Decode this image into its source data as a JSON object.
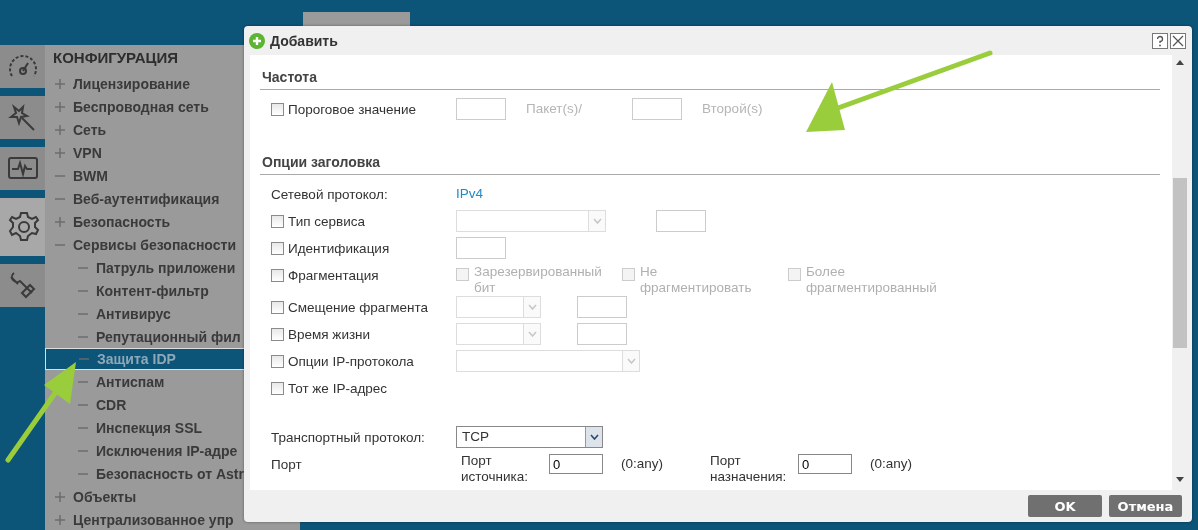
{
  "sidebar_icons": [
    {
      "selected": false
    },
    {
      "selected": false
    },
    {
      "selected": false
    },
    {
      "selected": true
    },
    {
      "selected": false
    }
  ],
  "nav": {
    "title": "КОНФИГУРАЦИЯ",
    "items": [
      {
        "label": "Лицензирование",
        "expanded": false,
        "selected": false
      },
      {
        "label": "Беспроводная сеть",
        "expanded": false,
        "selected": false
      },
      {
        "label": "Сеть",
        "expanded": false,
        "selected": false
      },
      {
        "label": "VPN",
        "expanded": false,
        "selected": false
      },
      {
        "label": "BWM",
        "expanded": true,
        "selected": false
      },
      {
        "label": "Веб-аутентификация",
        "expanded": true,
        "selected": false
      },
      {
        "label": "Безопасность",
        "expanded": false,
        "selected": false
      },
      {
        "label": "Сервисы безопасности",
        "expanded": true,
        "selected": false,
        "children": [
          {
            "label": "Патруль приложени",
            "selected": false
          },
          {
            "label": "Контент-фильтр",
            "selected": false
          },
          {
            "label": "Антивирус",
            "selected": false
          },
          {
            "label": "Репутационный фил",
            "selected": false
          },
          {
            "label": "Защита IDP",
            "selected": true
          },
          {
            "label": "Антиспам",
            "selected": false
          },
          {
            "label": "CDR",
            "selected": false
          },
          {
            "label": "Инспекция SSL",
            "selected": false
          },
          {
            "label": "Исключения IP-адре",
            "selected": false
          },
          {
            "label": "Безопасность от Astr",
            "selected": false
          }
        ]
      },
      {
        "label": "Объекты",
        "expanded": false,
        "selected": false
      },
      {
        "label": "Централизованное упр",
        "expanded": false,
        "selected": false
      }
    ]
  },
  "dialog": {
    "title": "Добавить",
    "sections": [
      {
        "title": "Частота",
        "rows": [
          {
            "kind": "option",
            "label": "Пороговое значение",
            "checked": false,
            "controls": [
              {
                "kind": "input",
                "disabled": true
              },
              {
                "kind": "text",
                "text": "Пакет(s)/",
                "disabled": true
              },
              {
                "kind": "input",
                "disabled": true
              },
              {
                "kind": "text",
                "text": "Второй(s)",
                "disabled": true
              }
            ]
          }
        ]
      },
      {
        "title": "Опции заголовка",
        "rows": [
          {
            "kind": "info",
            "label": "Сетевой протокол:",
            "value": "IPv4"
          },
          {
            "kind": "option",
            "label": "Тип сервиса",
            "checked": false,
            "controls": [
              {
                "kind": "wide-select",
                "disabled": true
              },
              {
                "kind": "input",
                "disabled": true
              }
            ]
          },
          {
            "kind": "option",
            "label": "Идентификация",
            "checked": false,
            "controls": [
              {
                "kind": "input",
                "disabled": true
              }
            ]
          },
          {
            "kind": "option",
            "label": "Фрагментация",
            "checked": false,
            "controls": [
              {
                "kind": "check",
                "text": "Зарезервированный бит",
                "checked": false,
                "disabled": true
              },
              {
                "kind": "check",
                "text": "Не фрагментировать",
                "checked": false,
                "disabled": true
              },
              {
                "kind": "check",
                "text": "Более фрагментированный",
                "checked": false,
                "disabled": true
              }
            ]
          },
          {
            "kind": "option",
            "label": "Смещение фрагмента",
            "checked": false,
            "controls": [
              {
                "kind": "short-select",
                "disabled": true
              },
              {
                "kind": "input",
                "disabled": true
              }
            ]
          },
          {
            "kind": "option",
            "label": "Время жизни",
            "checked": false,
            "controls": [
              {
                "kind": "short-select",
                "disabled": true
              },
              {
                "kind": "input",
                "disabled": true
              }
            ]
          },
          {
            "kind": "option",
            "label": "Опции IP-протокола",
            "checked": false,
            "controls": [
              {
                "kind": "long-select",
                "disabled": true
              }
            ]
          },
          {
            "kind": "option",
            "label": "Тот же IP-адрес",
            "checked": false,
            "controls": []
          }
        ]
      }
    ],
    "transport": {
      "label": "Транспортный протокол:",
      "value": "TCP"
    },
    "port": {
      "label": "Порт",
      "fields": [
        {
          "label": "Порт источника:",
          "value": "0",
          "hint": "(0:any)"
        },
        {
          "label": "Порт назначения:",
          "value": "0",
          "hint": "(0:any)"
        }
      ]
    },
    "buttons": [
      "OK",
      "Отмена"
    ]
  }
}
